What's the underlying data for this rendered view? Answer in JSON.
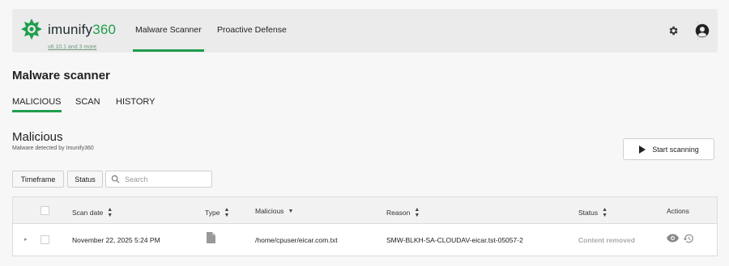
{
  "header": {
    "logo_text_prefix": "imunify",
    "logo_text_suffix": "360",
    "version": "v8.10.1 and 3 more",
    "nav": [
      {
        "label": "Malware Scanner",
        "active": true
      },
      {
        "label": "Proactive Defense",
        "active": false
      }
    ],
    "icons": [
      "gear-icon",
      "user-avatar-icon"
    ]
  },
  "page": {
    "title": "Malware scanner",
    "tabs": [
      {
        "label": "MALICIOUS",
        "active": true
      },
      {
        "label": "SCAN",
        "active": false
      },
      {
        "label": "HISTORY",
        "active": false
      }
    ]
  },
  "section": {
    "title": "Malicious",
    "subtitle": "Malware detected by Imunify360",
    "start_button": "Start scanning"
  },
  "filters": {
    "timeframe": "Timeframe",
    "status": "Status",
    "search_placeholder": "Search"
  },
  "table": {
    "columns": {
      "scan_date": "Scan date",
      "type": "Type",
      "malicious": "Malicious",
      "reason": "Reason",
      "status": "Status",
      "actions": "Actions"
    },
    "rows": [
      {
        "scan_date": "November 22, 2025 5:24 PM",
        "type_icon": "file-icon",
        "malicious": "/home/cpuser/eicar.com.txt",
        "reason": "SMW-BLKH-SA-CLOUDAV-eicar.tst-05057-2",
        "status": "Content removed",
        "actions": [
          "eye-icon",
          "restore-icon"
        ]
      }
    ]
  },
  "colors": {
    "accent": "#1f9e4d",
    "background": "#f7f7f7",
    "header_bg": "#ebebeb",
    "status_muted": "#aaaaaa"
  }
}
